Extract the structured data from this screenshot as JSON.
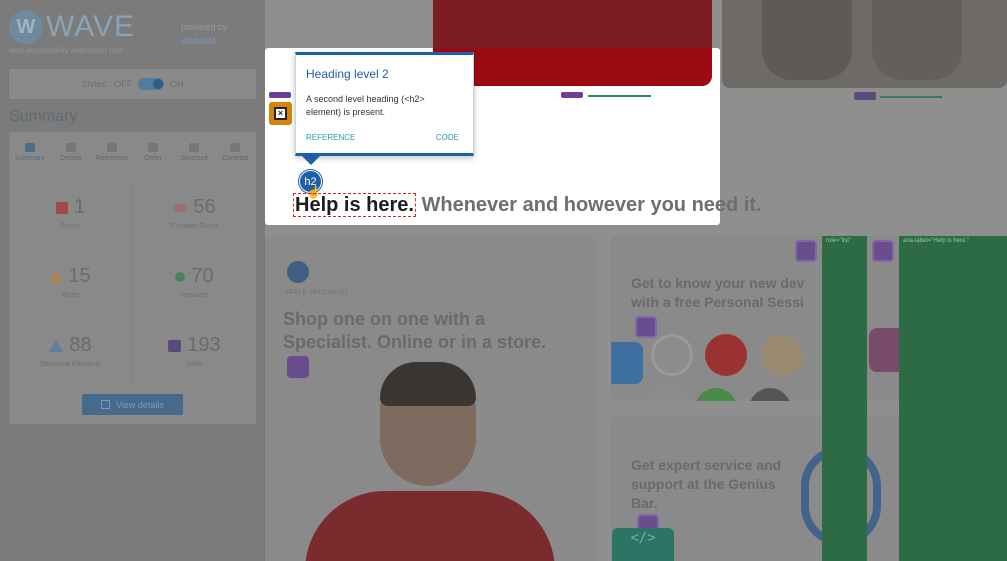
{
  "wave": {
    "title": "WAVE",
    "subtitle": "web accessibility evaluation tool",
    "powered_by": "powered by",
    "powered_brand": "WebAIM",
    "styles_label": "Styles:",
    "styles_off": "OFF",
    "styles_on": "ON",
    "summary_heading": "Summary",
    "tabs": [
      {
        "label": "Summary"
      },
      {
        "label": "Details"
      },
      {
        "label": "Reference"
      },
      {
        "label": "Order"
      },
      {
        "label": "Structure"
      },
      {
        "label": "Contrast"
      }
    ],
    "stats": {
      "errors": {
        "value": "1",
        "label": "Errors"
      },
      "contrast": {
        "value": "56",
        "label": "Contrast Errors"
      },
      "alerts": {
        "value": "15",
        "label": "Alerts"
      },
      "features": {
        "value": "70",
        "label": "Features"
      },
      "structural": {
        "value": "88",
        "label": "Structural Elements"
      },
      "aria": {
        "value": "193",
        "label": "ARIA"
      }
    },
    "view_details": "View details"
  },
  "tooltip": {
    "title": "Heading level 2",
    "body": "A second level heading (<h2> element) is present.",
    "reference": "REFERENCE",
    "code": "CODE"
  },
  "page": {
    "heading_strong": "Help is here.",
    "heading_rest": " Whenever and however you need it.",
    "h2_badge": "h2",
    "card_left_eyebrow": "APPLE SPECIALIST",
    "card_left_title": "Shop one on one with a Specialist. Online or in a store.",
    "card_right_title": "Get to know your new dev with a free Personal Sessi",
    "card_right2_title": "Get expert service and support at the Genius Bar.",
    "code_label": "</>",
    "green_label1": "role=\"list\"",
    "green_label2": "aria-label=\"Help is here.\""
  }
}
